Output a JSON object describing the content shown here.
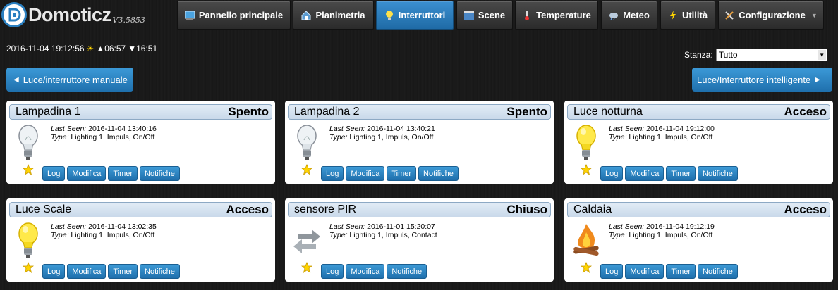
{
  "app": {
    "name": "Domoticz",
    "version": "V3.5853"
  },
  "nav": [
    {
      "label": "Pannello principale",
      "icon": "dashboard-icon",
      "active": false
    },
    {
      "label": "Planimetria",
      "icon": "floorplan-icon",
      "active": false
    },
    {
      "label": "Interruttori",
      "icon": "lightbulb-icon",
      "active": true
    },
    {
      "label": "Scene",
      "icon": "scene-icon",
      "active": false
    },
    {
      "label": "Temperature",
      "icon": "thermometer-icon",
      "active": false
    },
    {
      "label": "Meteo",
      "icon": "weather-icon",
      "active": false
    },
    {
      "label": "Utilità",
      "icon": "utility-icon",
      "active": false
    },
    {
      "label": "Configurazione",
      "icon": "tools-icon",
      "active": false
    }
  ],
  "status": {
    "datetime": "2016-11-04 19:12:56",
    "sunrise": "▲06:57",
    "sunset": "▼16:51"
  },
  "stanza": {
    "label": "Stanza:",
    "value": "Tutto"
  },
  "pager": {
    "left": "Luce/interruttore manuale",
    "right": "Luce/Interruttore intelligente"
  },
  "labels": {
    "last_seen": "Last Seen:",
    "type": "Type:"
  },
  "buttons": {
    "log": "Log",
    "edit": "Modifica",
    "timer": "Timer",
    "notify": "Notifiche"
  },
  "devices": [
    {
      "name": "Lampadina 1",
      "status": "Spento",
      "last_seen": "2016-11-04 13:40:16",
      "type": "Lighting 1, Impuls, On/Off",
      "icon": "bulb-off-icon",
      "has_timer": true
    },
    {
      "name": "Lampadina 2",
      "status": "Spento",
      "last_seen": "2016-11-04 13:40:21",
      "type": "Lighting 1, Impuls, On/Off",
      "icon": "bulb-off-icon",
      "has_timer": true
    },
    {
      "name": "Luce notturna",
      "status": "Acceso",
      "last_seen": "2016-11-04 19:12:00",
      "type": "Lighting 1, Impuls, On/Off",
      "icon": "bulb-on-icon",
      "has_timer": true
    },
    {
      "name": "Luce Scale",
      "status": "Acceso",
      "last_seen": "2016-11-04 13:02:35",
      "type": "Lighting 1, Impuls, On/Off",
      "icon": "bulb-on-icon",
      "has_timer": true
    },
    {
      "name": "sensore PIR",
      "status": "Chiuso",
      "last_seen": "2016-11-01 15:20:07",
      "type": "Lighting 1, Impuls, Contact",
      "icon": "contact-arrows-icon",
      "has_timer": false
    },
    {
      "name": "Caldaia",
      "status": "Acceso",
      "last_seen": "2016-11-04 19:12:19",
      "type": "Lighting 1, Impuls, On/Off",
      "icon": "fire-icon",
      "has_timer": true
    }
  ]
}
